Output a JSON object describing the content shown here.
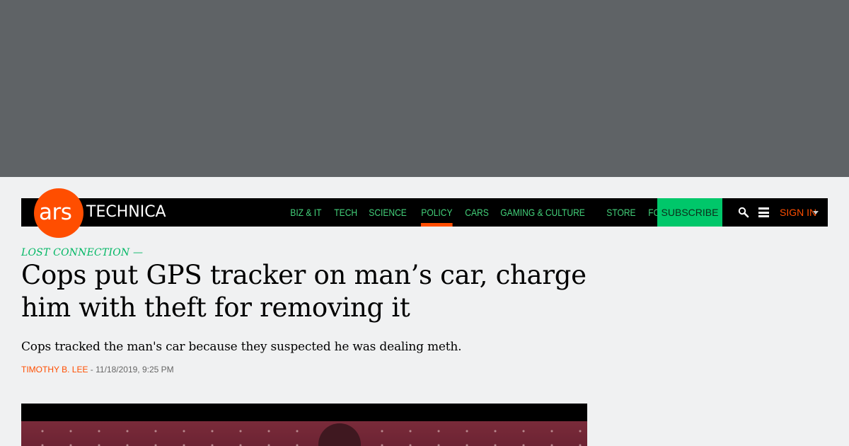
{
  "brand": {
    "logo_ars": "ars",
    "logo_technica": "TECHNICA",
    "color_accent": "#ff4e00",
    "color_nav_text": "#43d17a",
    "color_subscribe": "#00c76a"
  },
  "nav": {
    "items": [
      {
        "label": "BIZ & IT",
        "active": false
      },
      {
        "label": "TECH",
        "active": false
      },
      {
        "label": "SCIENCE",
        "active": false
      },
      {
        "label": "POLICY",
        "active": true
      },
      {
        "label": "CARS",
        "active": false
      },
      {
        "label": "GAMING & CULTURE",
        "active": false
      },
      {
        "label": "STORE",
        "active": false
      },
      {
        "label": "FORUMS",
        "active": false
      }
    ],
    "subscribe_label": "SUBSCRIBE",
    "search_icon": "search-icon",
    "menu_icon": "hamburger-menu-icon",
    "signin_label": "SIGN IN"
  },
  "article": {
    "kicker": "LOST CONNECTION —",
    "headline": "Cops put GPS tracker on man’s car, charge him with theft for removing it",
    "dek": "Cops tracked the man's car because they suspected he was dealing meth.",
    "author": "TIMOTHY B. LEE",
    "byline_sep": " - ",
    "timestamp": "11/18/2019, 9:25 PM"
  }
}
